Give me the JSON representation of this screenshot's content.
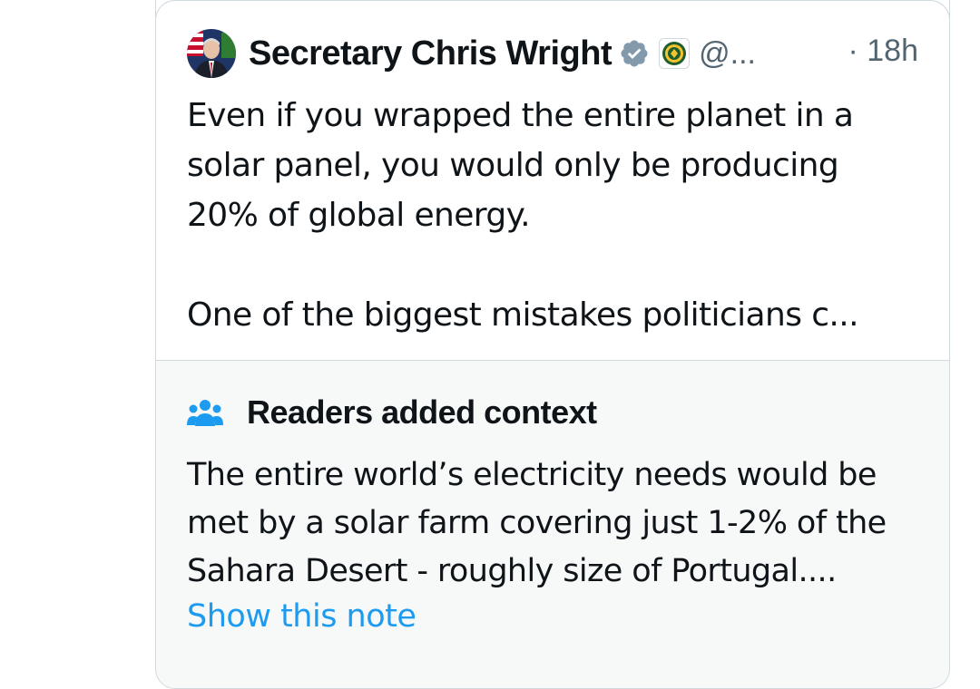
{
  "tweet": {
    "author_name": "Secretary Chris Wright",
    "handle": "@...",
    "time": "· 18h",
    "avatar_icon": "person-portrait-icon",
    "verified_icon": "verified-badge-icon",
    "affiliation_icon": "department-of-energy-seal-icon",
    "text_lines": [
      "Even if you wrapped the entire planet in a",
      "solar panel, you would only be producing",
      "20% of global energy.",
      "One of the biggest mistakes politicians c..."
    ]
  },
  "note": {
    "icon": "people-icon",
    "title": "Readers added context",
    "body_lines": [
      "The entire world’s electricity needs would be",
      "met by a solar farm covering just 1-2% of the",
      "Sahara Desert - roughly size of Portugal...."
    ],
    "show_label": "Show this note"
  },
  "colors": {
    "text": "#0f1419",
    "secondary": "#536471",
    "link": "#1d9bf0",
    "note_bg": "#f7f9f9",
    "border": "#cfd9de",
    "verified_gray": "#829aab"
  }
}
